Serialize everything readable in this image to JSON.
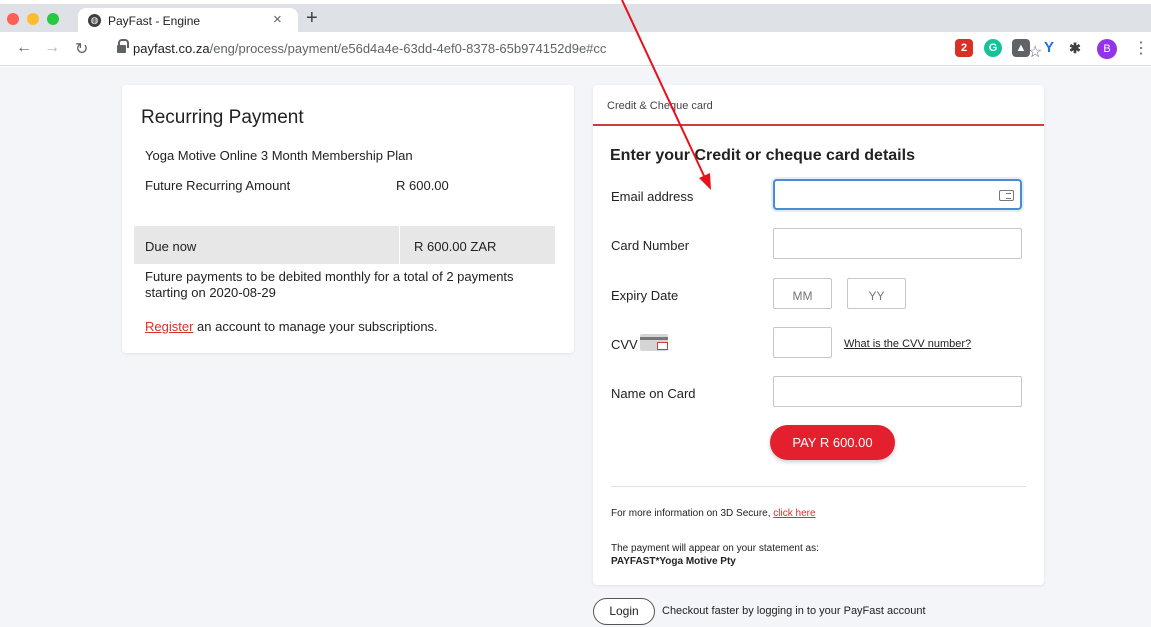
{
  "browser": {
    "tab_title": "PayFast - Engine",
    "url_domain": "payfast.co.za",
    "url_path": "/eng/process/payment/e56d4a4e-63dd-4ef0-8378-65b974152d9e#cc",
    "extension_badge": "2",
    "profile_initial": "B"
  },
  "summary": {
    "title": "Recurring Payment",
    "plan_name": "Yoga Motive Online 3 Month Membership Plan",
    "future_label": "Future Recurring Amount",
    "future_value": "R 600.00",
    "due_label": "Due now",
    "due_value": "R 600.00  ZAR",
    "note": "Future payments to be debited monthly for a total of 2 payments starting on 2020-08-29",
    "register_link": "Register",
    "register_rest": " an account to manage your subscriptions."
  },
  "form": {
    "tab_label": "Credit & Cheque card",
    "heading": "Enter your Credit or cheque card details",
    "email_label": "Email address",
    "card_label": "Card Number",
    "expiry_label": "Expiry Date",
    "expiry_month_placeholder": "MM",
    "expiry_year_placeholder": "YY",
    "cvv_label": "CVV",
    "cvv_link": "What is the CVV number?",
    "name_label": "Name on Card",
    "pay_button": "PAY R 600.00",
    "info_text": "For more information on 3D Secure, ",
    "info_link": "click here",
    "statement_line1": "The payment will appear on your statement as:",
    "statement_line2": "PAYFAST*Yoga Motive Pty"
  },
  "login": {
    "button": "Login",
    "text": "Checkout faster by logging in to your PayFast account"
  },
  "colors": {
    "accent_red": "#e4202e",
    "focus_blue": "#4a8bd1",
    "page_bg": "#f4f5f8"
  }
}
